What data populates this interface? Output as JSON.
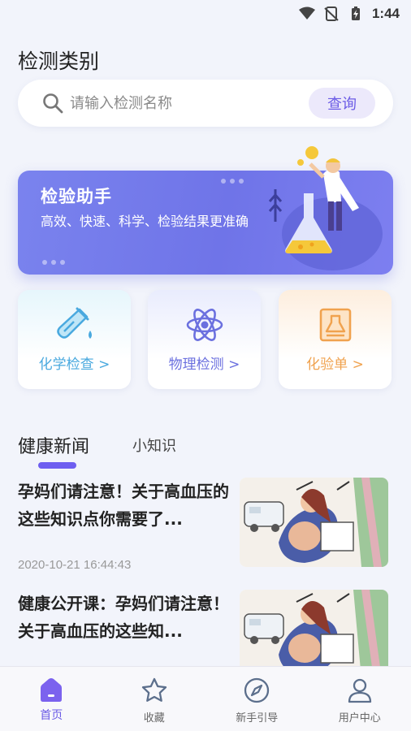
{
  "status_bar": {
    "time": "1:44"
  },
  "page_title": "检测类别",
  "search": {
    "placeholder": "请输入检测名称",
    "button_label": "查询"
  },
  "banner": {
    "title": "检验助手",
    "description": "高效、快速、科学、检验结果更准确"
  },
  "categories": [
    {
      "label": "化学检查 >",
      "icon": "test-tube-icon",
      "color": "#49a9df"
    },
    {
      "label": "物理检测 >",
      "icon": "atom-icon",
      "color": "#6b70df"
    },
    {
      "label": "化验单 >",
      "icon": "report-icon",
      "color": "#f0a24e"
    }
  ],
  "tabs": [
    {
      "label": "健康新闻",
      "active": true
    },
    {
      "label": "小知识",
      "active": false
    }
  ],
  "news": [
    {
      "title": "孕妈们请注意！关于高血压的这些知识点你需要了...",
      "date": "2020-10-21 16:44:43"
    },
    {
      "title": "健康公开课：孕妈们请注意！关于高血压的这些知...",
      "date": ""
    }
  ],
  "bottom_nav": [
    {
      "label": "首页",
      "icon": "home-icon",
      "active": true
    },
    {
      "label": "收藏",
      "icon": "star-icon",
      "active": false
    },
    {
      "label": "新手引导",
      "icon": "compass-icon",
      "active": false
    },
    {
      "label": "用户中心",
      "icon": "user-icon",
      "active": false
    }
  ],
  "colors": {
    "accent": "#6b5be6",
    "banner": "#7579ec",
    "background": "#f2f4fb"
  }
}
